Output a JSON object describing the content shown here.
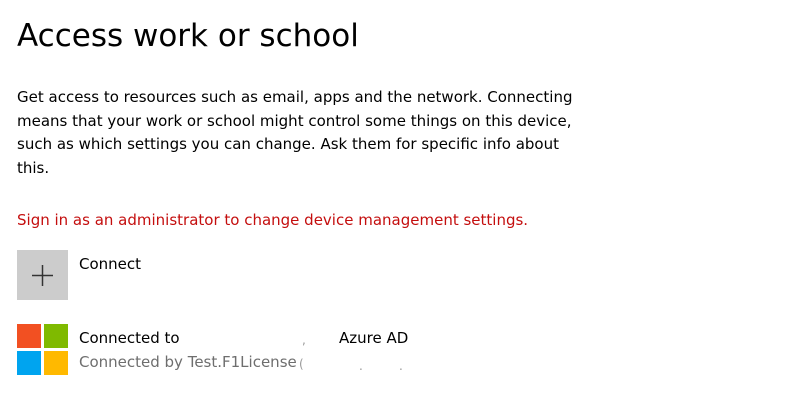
{
  "page": {
    "title": "Access work or school",
    "description": "Get access to resources such as email, apps and the network. Connecting means that your work or school might control some things on this device, such as which settings you can change. Ask them for specific info about this.",
    "admin_warning": "Sign in as an administrator to change device management settings."
  },
  "connect": {
    "label": "Connect",
    "icon": "plus-icon"
  },
  "account": {
    "title_prefix": "Connected to",
    "title_suffix": "Azure AD",
    "subtitle_prefix": "Connected by Test.F1License",
    "icon": "microsoft-logo-icon"
  },
  "colors": {
    "warning": "#c40e0e",
    "tile_background": "#cccccc",
    "secondary_text": "#6e6e6e",
    "ms_red": "#f25022",
    "ms_green": "#7fba00",
    "ms_blue": "#00a4ef",
    "ms_yellow": "#ffb900"
  }
}
